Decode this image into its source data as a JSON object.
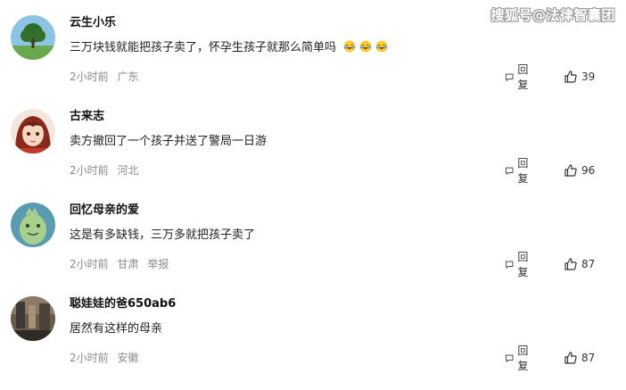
{
  "watermark": "搜狐号@法律智囊团",
  "comments": [
    {
      "username": "云生小乐",
      "text": "三万块钱就能把孩子卖了，怀孕生孩子就那么简单吗",
      "emojis": [
        "laughing-crying-emoji",
        "laughing-crying-emoji",
        "laughing-crying-emoji"
      ],
      "time": "2小时前",
      "location": "广东",
      "report": "",
      "reply_label": "回复",
      "likes": "39"
    },
    {
      "username": "古来志",
      "text": "卖方撤回了一个孩子并送了警局一日游",
      "emojis": [],
      "time": "2小时前",
      "location": "河北",
      "report": "",
      "reply_label": "回复",
      "likes": "96"
    },
    {
      "username": "回忆母亲的爱",
      "text": "这是有多缺钱，三万多就把孩子卖了",
      "emojis": [],
      "time": "2小时前",
      "location": "甘肃",
      "report": "举报",
      "reply_label": "回复",
      "likes": "87"
    },
    {
      "username": "聪娃娃的爸650ab6",
      "text": "居然有这样的母亲",
      "emojis": [],
      "time": "2小时前",
      "location": "安徽",
      "report": "",
      "reply_label": "回复",
      "likes": "87"
    }
  ]
}
